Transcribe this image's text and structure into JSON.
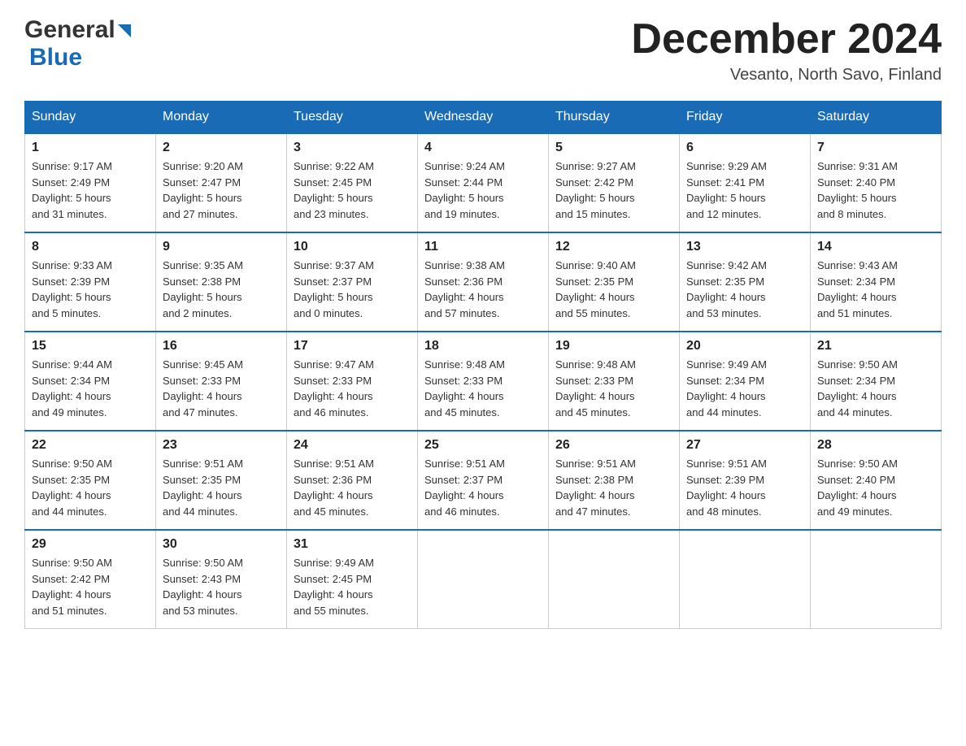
{
  "header": {
    "title": "December 2024",
    "location": "Vesanto, North Savo, Finland",
    "logo_general": "General",
    "logo_blue": "Blue"
  },
  "columns": [
    "Sunday",
    "Monday",
    "Tuesday",
    "Wednesday",
    "Thursday",
    "Friday",
    "Saturday"
  ],
  "weeks": [
    [
      {
        "day": "1",
        "info": "Sunrise: 9:17 AM\nSunset: 2:49 PM\nDaylight: 5 hours\nand 31 minutes."
      },
      {
        "day": "2",
        "info": "Sunrise: 9:20 AM\nSunset: 2:47 PM\nDaylight: 5 hours\nand 27 minutes."
      },
      {
        "day": "3",
        "info": "Sunrise: 9:22 AM\nSunset: 2:45 PM\nDaylight: 5 hours\nand 23 minutes."
      },
      {
        "day": "4",
        "info": "Sunrise: 9:24 AM\nSunset: 2:44 PM\nDaylight: 5 hours\nand 19 minutes."
      },
      {
        "day": "5",
        "info": "Sunrise: 9:27 AM\nSunset: 2:42 PM\nDaylight: 5 hours\nand 15 minutes."
      },
      {
        "day": "6",
        "info": "Sunrise: 9:29 AM\nSunset: 2:41 PM\nDaylight: 5 hours\nand 12 minutes."
      },
      {
        "day": "7",
        "info": "Sunrise: 9:31 AM\nSunset: 2:40 PM\nDaylight: 5 hours\nand 8 minutes."
      }
    ],
    [
      {
        "day": "8",
        "info": "Sunrise: 9:33 AM\nSunset: 2:39 PM\nDaylight: 5 hours\nand 5 minutes."
      },
      {
        "day": "9",
        "info": "Sunrise: 9:35 AM\nSunset: 2:38 PM\nDaylight: 5 hours\nand 2 minutes."
      },
      {
        "day": "10",
        "info": "Sunrise: 9:37 AM\nSunset: 2:37 PM\nDaylight: 5 hours\nand 0 minutes."
      },
      {
        "day": "11",
        "info": "Sunrise: 9:38 AM\nSunset: 2:36 PM\nDaylight: 4 hours\nand 57 minutes."
      },
      {
        "day": "12",
        "info": "Sunrise: 9:40 AM\nSunset: 2:35 PM\nDaylight: 4 hours\nand 55 minutes."
      },
      {
        "day": "13",
        "info": "Sunrise: 9:42 AM\nSunset: 2:35 PM\nDaylight: 4 hours\nand 53 minutes."
      },
      {
        "day": "14",
        "info": "Sunrise: 9:43 AM\nSunset: 2:34 PM\nDaylight: 4 hours\nand 51 minutes."
      }
    ],
    [
      {
        "day": "15",
        "info": "Sunrise: 9:44 AM\nSunset: 2:34 PM\nDaylight: 4 hours\nand 49 minutes."
      },
      {
        "day": "16",
        "info": "Sunrise: 9:45 AM\nSunset: 2:33 PM\nDaylight: 4 hours\nand 47 minutes."
      },
      {
        "day": "17",
        "info": "Sunrise: 9:47 AM\nSunset: 2:33 PM\nDaylight: 4 hours\nand 46 minutes."
      },
      {
        "day": "18",
        "info": "Sunrise: 9:48 AM\nSunset: 2:33 PM\nDaylight: 4 hours\nand 45 minutes."
      },
      {
        "day": "19",
        "info": "Sunrise: 9:48 AM\nSunset: 2:33 PM\nDaylight: 4 hours\nand 45 minutes."
      },
      {
        "day": "20",
        "info": "Sunrise: 9:49 AM\nSunset: 2:34 PM\nDaylight: 4 hours\nand 44 minutes."
      },
      {
        "day": "21",
        "info": "Sunrise: 9:50 AM\nSunset: 2:34 PM\nDaylight: 4 hours\nand 44 minutes."
      }
    ],
    [
      {
        "day": "22",
        "info": "Sunrise: 9:50 AM\nSunset: 2:35 PM\nDaylight: 4 hours\nand 44 minutes."
      },
      {
        "day": "23",
        "info": "Sunrise: 9:51 AM\nSunset: 2:35 PM\nDaylight: 4 hours\nand 44 minutes."
      },
      {
        "day": "24",
        "info": "Sunrise: 9:51 AM\nSunset: 2:36 PM\nDaylight: 4 hours\nand 45 minutes."
      },
      {
        "day": "25",
        "info": "Sunrise: 9:51 AM\nSunset: 2:37 PM\nDaylight: 4 hours\nand 46 minutes."
      },
      {
        "day": "26",
        "info": "Sunrise: 9:51 AM\nSunset: 2:38 PM\nDaylight: 4 hours\nand 47 minutes."
      },
      {
        "day": "27",
        "info": "Sunrise: 9:51 AM\nSunset: 2:39 PM\nDaylight: 4 hours\nand 48 minutes."
      },
      {
        "day": "28",
        "info": "Sunrise: 9:50 AM\nSunset: 2:40 PM\nDaylight: 4 hours\nand 49 minutes."
      }
    ],
    [
      {
        "day": "29",
        "info": "Sunrise: 9:50 AM\nSunset: 2:42 PM\nDaylight: 4 hours\nand 51 minutes."
      },
      {
        "day": "30",
        "info": "Sunrise: 9:50 AM\nSunset: 2:43 PM\nDaylight: 4 hours\nand 53 minutes."
      },
      {
        "day": "31",
        "info": "Sunrise: 9:49 AM\nSunset: 2:45 PM\nDaylight: 4 hours\nand 55 minutes."
      },
      null,
      null,
      null,
      null
    ]
  ]
}
